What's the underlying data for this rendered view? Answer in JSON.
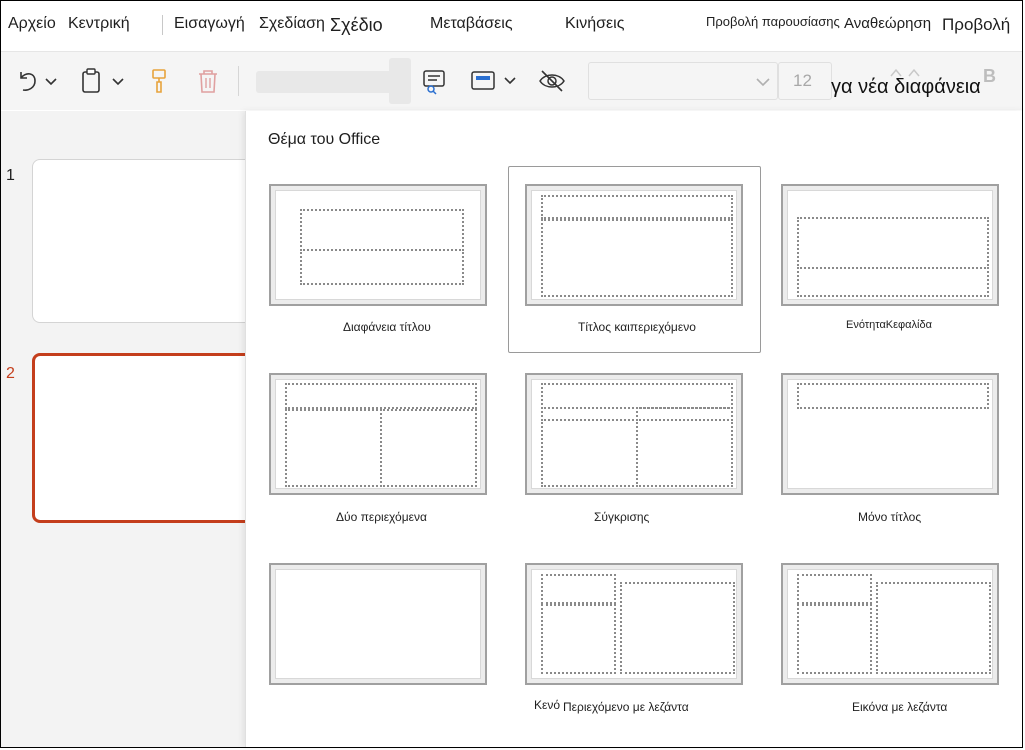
{
  "menu": {
    "file": "Αρχείο",
    "home": "Κεντρική",
    "insert": "Εισαγωγή",
    "draw": "Σχεδίαση",
    "design": "Σχέδιο",
    "transitions": "Μεταβάσεις",
    "animations": "Κινήσεις",
    "slideshow": "Προβολή παρουσίασης",
    "review": "Αναθεώρηση",
    "view": "Προβολή"
  },
  "toolbar": {
    "font_size": "12",
    "new_slide_text": "γα νέα διαφάνεια"
  },
  "slides": [
    {
      "number": "1"
    },
    {
      "number": "2"
    }
  ],
  "gallery": {
    "title": "Θέμα του Office",
    "layouts": [
      {
        "label": "Διαφάνεια τίτλου"
      },
      {
        "label": "Τίτλος καιπεριεχόμενο"
      },
      {
        "label": "ΕνότηταΚεφαλίδα"
      },
      {
        "label": "Δύο περιεχόμενα"
      },
      {
        "label": "Σύγκρισης"
      },
      {
        "label": "Μόνο τίτλος"
      },
      {
        "label": "Κενό"
      },
      {
        "label": "Περιεχόμενο με λεζάντα"
      },
      {
        "label": "Εικόνα με λεζάντα"
      }
    ]
  },
  "colors": {
    "selected_slide_border": "#c43e1c",
    "format_painter": "#e8a33c",
    "delete_icon": "#e0a0a0"
  }
}
